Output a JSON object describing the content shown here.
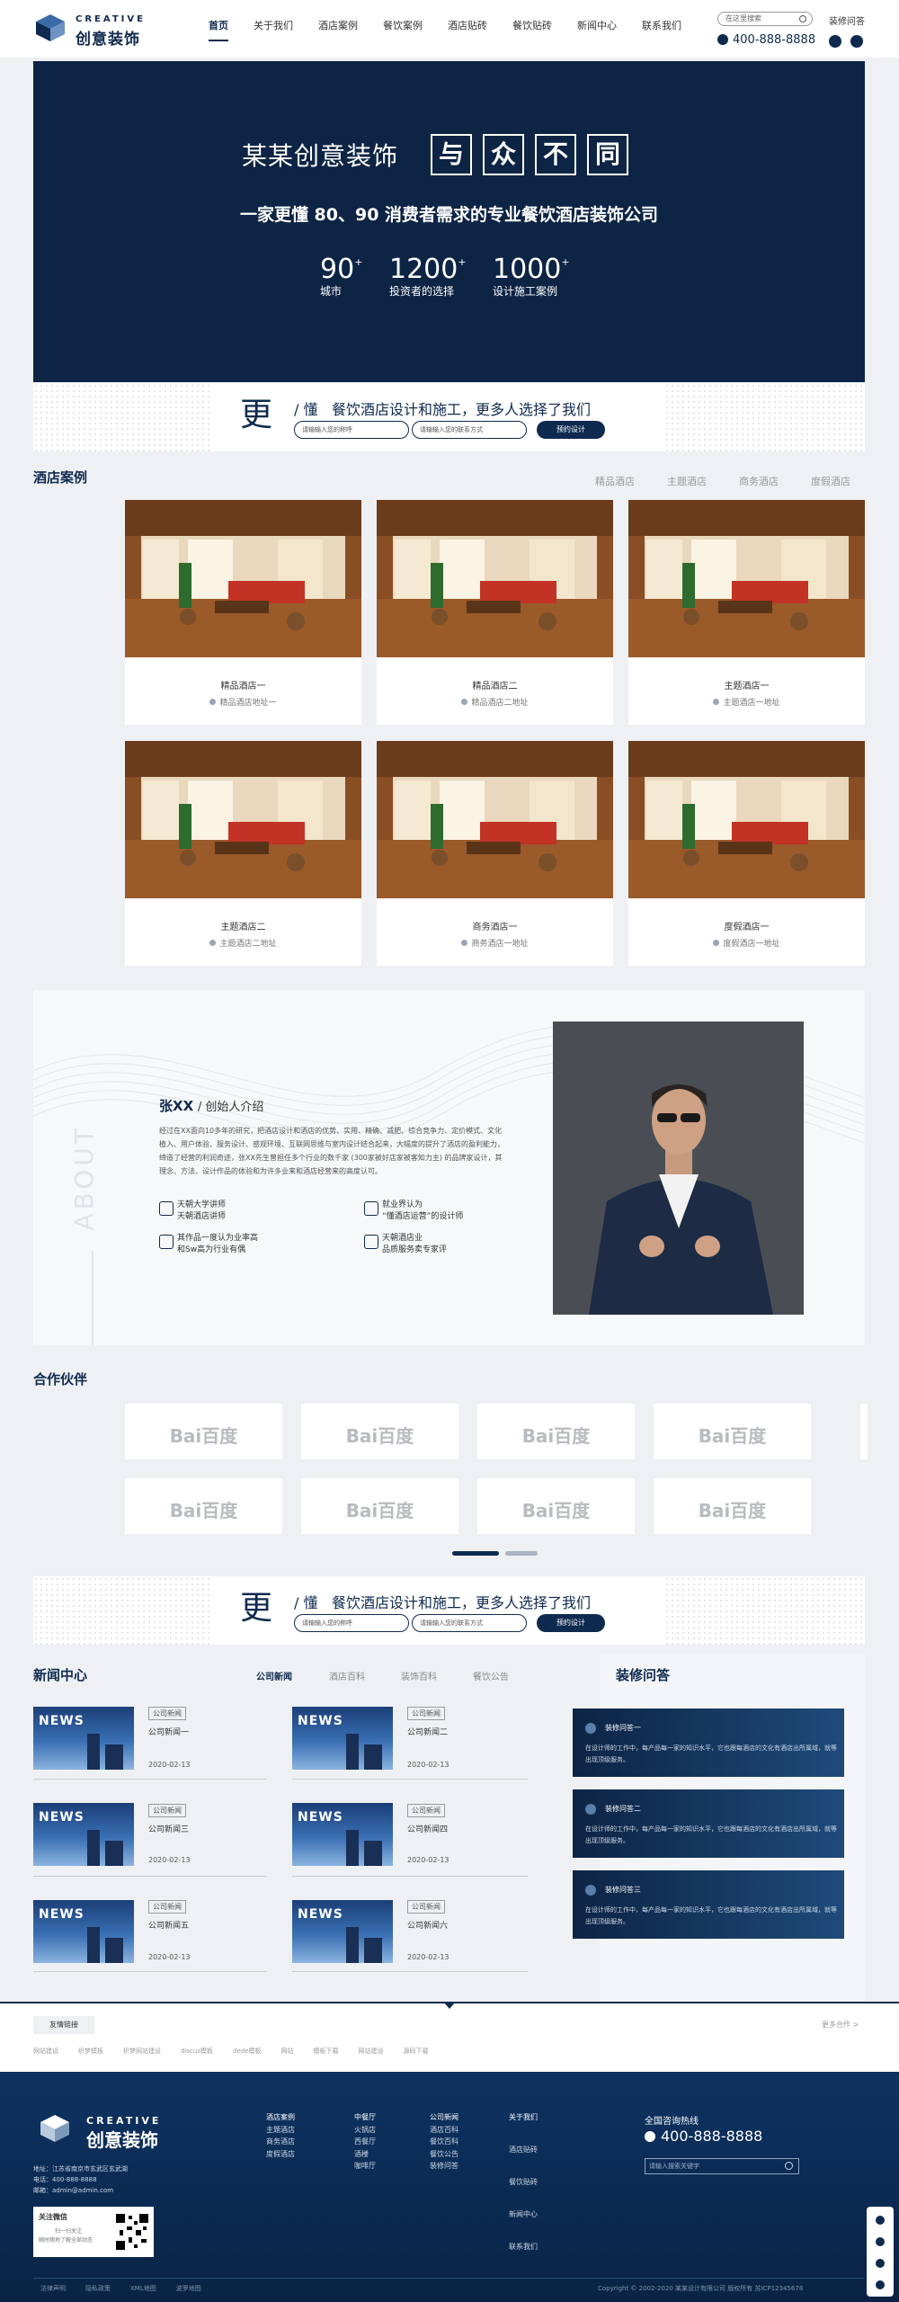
{
  "header": {
    "logo_en": "CREATIVE",
    "logo_cn": "创意装饰",
    "nav": [
      "首页",
      "关于我们",
      "酒店案例",
      "餐饮案例",
      "酒店贴砖",
      "餐饮贴砖",
      "新闻中心",
      "联系我们"
    ],
    "search_placeholder": "在这里搜索",
    "faq_link": "装修问答",
    "phone": "400-888-8888"
  },
  "hero": {
    "title": "某某创意装饰",
    "boxes": [
      "与",
      "众",
      "不",
      "同"
    ],
    "subtitle": "一家更懂 80、90 消费者需求的专业餐饮酒店装饰公司",
    "stats": [
      {
        "num": "90",
        "sup": "+",
        "label": "城市"
      },
      {
        "num": "1200",
        "sup": "+",
        "label": "投资者的选择"
      },
      {
        "num": "1000",
        "sup": "+",
        "label": "设计施工案例"
      }
    ]
  },
  "strip": {
    "big": "更",
    "slash": "/ 懂",
    "text": "餐饮酒店设计和施工，更多人选择了我们",
    "input1": "请输输入您的称呼",
    "input2": "请输输入您的联系方式",
    "button": "预约设计"
  },
  "cases": {
    "title": "酒店案例",
    "tabs": [
      "精品酒店",
      "主题酒店",
      "商务酒店",
      "度假酒店"
    ],
    "items": [
      {
        "name": "精品酒店一",
        "addr": "精品酒店地址一"
      },
      {
        "name": "精品酒店二",
        "addr": "精品酒店二地址"
      },
      {
        "name": "主题酒店一",
        "addr": "主题酒店一地址"
      },
      {
        "name": "主题酒店二",
        "addr": "主题酒店二地址"
      },
      {
        "name": "商务酒店一",
        "addr": "商务酒店一地址"
      },
      {
        "name": "度假酒店一",
        "addr": "度假酒店一地址"
      }
    ]
  },
  "about": {
    "vertical": "ABOUT",
    "name": "张XX",
    "role": "/ 创始人介绍",
    "text": "经过在XX面向10多年的研究，把酒店设计和酒店的优势、实用、精确、减肥、综合竞争力、定价模式、文化植入、用户体验、服务设计、感观环境、互联网思维与室内设计结合起来，大幅度的提升了酒店的盈利能力，缔造了经营的利润奇迹，张XX先生曾担任多个行业的数千家 (300家被好店家被客知力主) 的品牌家设计，其理念、方法、设计作品的体验和为许多业来和酒店经营来的高度认可。",
    "features": [
      {
        "l1": "天朝大学讲师",
        "l2": "天朝酒店讲师"
      },
      {
        "l1": "就业界认为",
        "l2": "“懂酒店运营”的设计师"
      },
      {
        "l1": "其作品一度认为业率高",
        "l2": "和Sw高为行业有偶"
      },
      {
        "l1": "天朝酒店业",
        "l2": "品质服务卖专家评"
      }
    ]
  },
  "partners": {
    "title": "合作伙伴",
    "logo_text": "Bai百度"
  },
  "strip2": {
    "big": "更",
    "slash": "/ 懂",
    "text": "餐饮酒店设计和施工，更多人选择了我们",
    "input1": "请输输入您的称呼",
    "input2": "请输输入您的联系方式",
    "button": "预约设计"
  },
  "news": {
    "title": "新闻中心",
    "tabs": [
      "公司新闻",
      "酒店百科",
      "装饰百科",
      "餐饮公告"
    ],
    "thumb_text": "NEWS",
    "items": [
      {
        "tag": "公司新闻",
        "title": "公司新闻一",
        "date": "2020-02-13"
      },
      {
        "tag": "公司新闻",
        "title": "公司新闻二",
        "date": "2020-02-13"
      },
      {
        "tag": "公司新闻",
        "title": "公司新闻三",
        "date": "2020-02-13"
      },
      {
        "tag": "公司新闻",
        "title": "公司新闻四",
        "date": "2020-02-13"
      },
      {
        "tag": "公司新闻",
        "title": "公司新闻五",
        "date": "2020-02-13"
      },
      {
        "tag": "公司新闻",
        "title": "公司新闻六",
        "date": "2020-02-13"
      }
    ]
  },
  "qa": {
    "title": "装修问答",
    "items": [
      {
        "title": "装修问答一",
        "desc": "在设计师的工作中，每产品每一家的知识水平，它也跟每酒店的文化有酒店出所属域，就等出现顶级服务。"
      },
      {
        "title": "装修问答二",
        "desc": "在设计师的工作中，每产品每一家的知识水平，它也跟每酒店的文化有酒店出所属域，就等出现顶级服务。"
      },
      {
        "title": "装修问答三",
        "desc": "在设计师的工作中，每产品每一家的知识水平，它也跟每酒店的文化有酒店出所属域，就等出现顶级服务。"
      }
    ]
  },
  "friend": {
    "tab": "友情链接",
    "more": "更多合作 >",
    "links": [
      "网站建设",
      "织梦模板",
      "织梦网站建设",
      "discuz模板",
      "dede模板",
      "网站",
      "模板下载",
      "网站建设",
      "源码下载"
    ]
  },
  "footer": {
    "logo_en": "CREATIVE",
    "logo_cn": "创意装饰",
    "address": "地址：江苏省南京市玄武区玄武湖",
    "phone": "电话：400-888-8888",
    "email": "邮箱：admin@admin.com",
    "follow_title": "关注微信",
    "follow_sub1": "扫一扫关注",
    "follow_sub2": "随时随地了解全部动态",
    "col1": [
      "酒店案例",
      "主题酒店",
      "商务酒店",
      "度假酒店"
    ],
    "col2": [
      "中餐厅",
      "火锅店",
      "西餐厅",
      "酒楼",
      "咖啡厅"
    ],
    "col3": [
      "公司新闻",
      "酒店百科",
      "餐饮百科",
      "餐饮公告",
      "装修问答"
    ],
    "col4": [
      "关于我们",
      "酒店贴砖",
      "餐饮贴砖",
      "新闻中心",
      "联系我们"
    ],
    "hotline_label": "全国咨询热线",
    "hotline": "400-888-8888",
    "search_placeholder": "请输入搜索关键字",
    "bottom_links": [
      "法律声明",
      "隐私政策",
      "XML地图",
      "波罗地图"
    ],
    "copyright": "Copyright © 2002-2020 某某设计有限公司 版权所有 苏ICP12345678"
  }
}
